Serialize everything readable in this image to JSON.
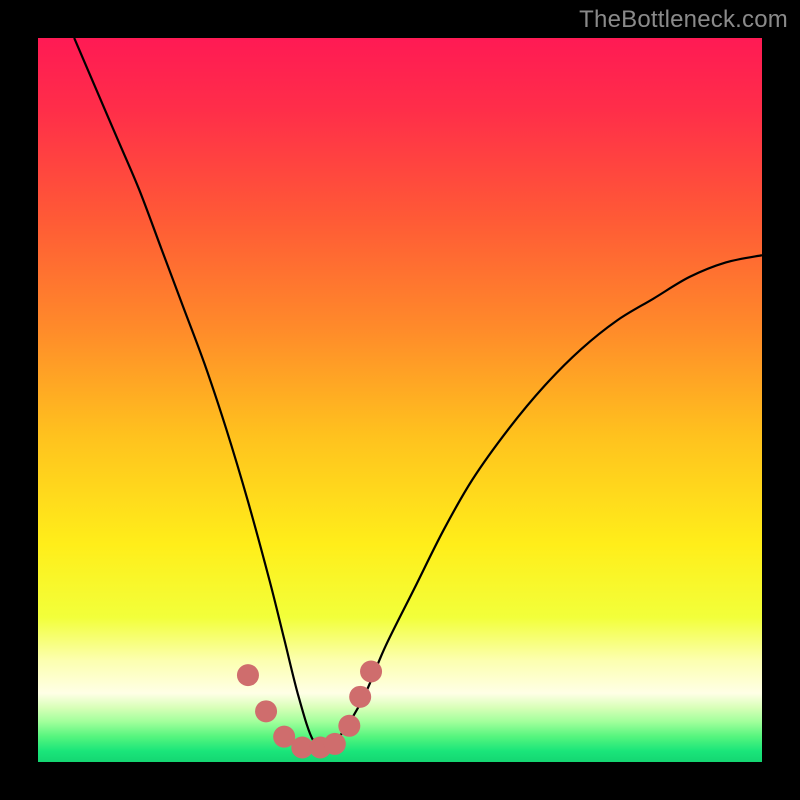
{
  "watermark": "TheBottleneck.com",
  "gradient_stops": [
    {
      "offset": 0.0,
      "color": "#ff1a54"
    },
    {
      "offset": 0.1,
      "color": "#ff2e49"
    },
    {
      "offset": 0.25,
      "color": "#ff5a36"
    },
    {
      "offset": 0.4,
      "color": "#ff8a2a"
    },
    {
      "offset": 0.55,
      "color": "#ffc21e"
    },
    {
      "offset": 0.7,
      "color": "#ffee1a"
    },
    {
      "offset": 0.8,
      "color": "#f2ff3a"
    },
    {
      "offset": 0.86,
      "color": "#fcffb0"
    },
    {
      "offset": 0.905,
      "color": "#ffffe6"
    },
    {
      "offset": 0.925,
      "color": "#d8ffb8"
    },
    {
      "offset": 0.945,
      "color": "#9fff9a"
    },
    {
      "offset": 0.965,
      "color": "#55f57e"
    },
    {
      "offset": 0.985,
      "color": "#1ae57a"
    },
    {
      "offset": 1.0,
      "color": "#14d672"
    }
  ],
  "curve_color": "#000000",
  "curve_width": 2.2,
  "dot_color": "#cf6d6d",
  "dot_radius": 11,
  "chart_data": {
    "type": "line",
    "title": "",
    "xlabel": "",
    "ylabel": "",
    "xlim": [
      0,
      100
    ],
    "ylim": [
      0,
      100
    ],
    "grid": false,
    "description": "Bottleneck curve: a steep V-shaped curve descending from near 100% on the left, reaching ~2% around x≈38, then rising again toward ~70% at x=100. Red dots mark points near the valley between roughly x≈29 and x≈46.",
    "series": [
      {
        "name": "curve",
        "x": [
          5,
          8,
          11,
          14,
          17,
          20,
          23,
          26,
          29,
          32,
          34,
          36,
          38,
          40,
          42,
          45,
          48,
          52,
          56,
          60,
          65,
          70,
          75,
          80,
          85,
          90,
          95,
          100
        ],
        "y": [
          100,
          93,
          86,
          79,
          71,
          63,
          55,
          46,
          36,
          25,
          17,
          9,
          3,
          2,
          4,
          9,
          16,
          24,
          32,
          39,
          46,
          52,
          57,
          61,
          64,
          67,
          69,
          70
        ]
      }
    ],
    "dots": {
      "x": [
        29.0,
        31.5,
        34.0,
        36.5,
        39.0,
        41.0,
        43.0,
        44.5,
        46.0
      ],
      "y": [
        12.0,
        7.0,
        3.5,
        2.0,
        2.0,
        2.5,
        5.0,
        9.0,
        12.5
      ]
    }
  }
}
